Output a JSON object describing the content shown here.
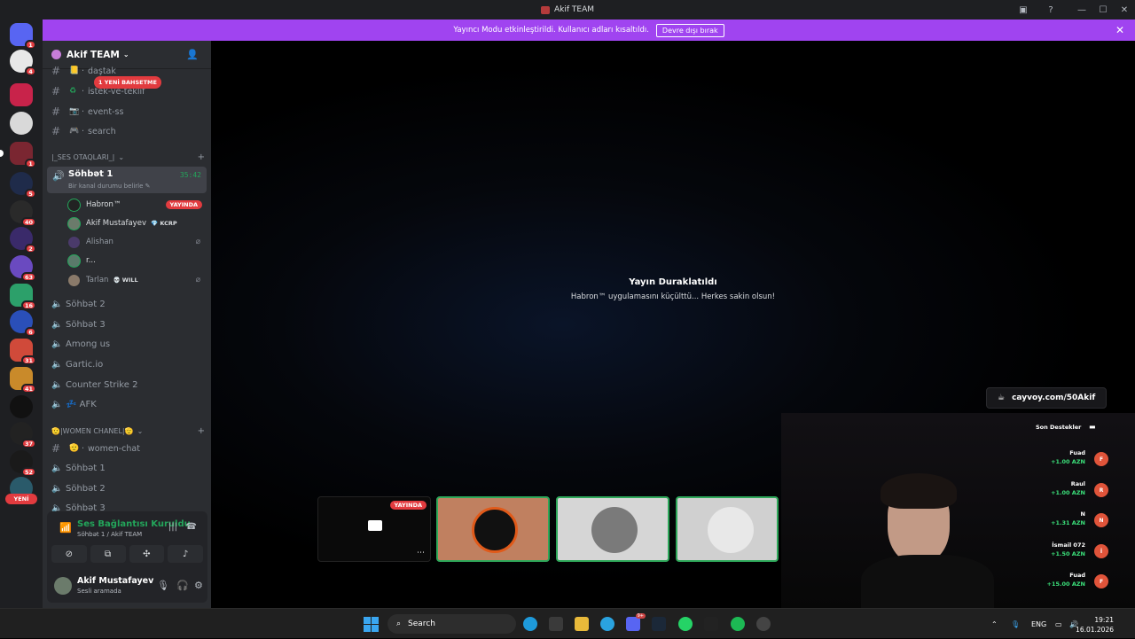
{
  "window": {
    "title": "Akif TEAM"
  },
  "banner": {
    "text": "Yayıncı Modu etkinleştirildi. Kullanıcı adları kısaltıldı.",
    "button": "Devre dışı bırak",
    "close_icon": "close-icon"
  },
  "guild_badges": [
    "1",
    "4",
    "1",
    "5",
    "40",
    "2",
    "63",
    "16",
    "6",
    "31",
    "41",
    "37",
    "52"
  ],
  "guild_new": "YENİ",
  "server": {
    "name": "Akif TEAM"
  },
  "mention_pill": "1 YENİ BAHSETME",
  "text_channels": [
    {
      "name": "daştak",
      "emoji": "📒"
    },
    {
      "name": "istek-ve-teklif",
      "emoji": "♻"
    },
    {
      "name": "event-ss",
      "emoji": "📷"
    },
    {
      "name": "search",
      "emoji": "🎮"
    }
  ],
  "categories": {
    "voice": "|_SES OTAQLARI_|",
    "women": "🫡|WOMEN CHANEL|🫡"
  },
  "active_voice": {
    "name": "Söhbət 1",
    "status": "Bir kanal durumu belirle",
    "timer": "35:42"
  },
  "voice_users": [
    {
      "name": "Habron™",
      "badge": "YAYINDA",
      "tag": ""
    },
    {
      "name": "Akif Mustafayev",
      "badge": "",
      "tag": "💎 KCRP"
    },
    {
      "name": "Alishan",
      "badge": "",
      "tag": ""
    },
    {
      "name": "r...",
      "badge": "",
      "tag": ""
    },
    {
      "name": "Tarlan",
      "badge": "",
      "tag": "💀 WILL"
    }
  ],
  "voice_channels": [
    {
      "name": "Söhbət 2"
    },
    {
      "name": "Söhbət 3"
    },
    {
      "name": "Among us"
    },
    {
      "name": "Gartic.io"
    },
    {
      "name": "Counter Strike 2"
    },
    {
      "name": "💤 AFK"
    }
  ],
  "women_channels": [
    {
      "name": "women-chat",
      "type": "text"
    },
    {
      "name": "Söhbət 1",
      "type": "voice"
    },
    {
      "name": "Söhbət 2",
      "type": "voice"
    },
    {
      "name": "Söhbət 3",
      "type": "voice"
    }
  ],
  "voice_panel": {
    "status": "Ses Bağlantısı Kuruldu",
    "sub": "Söhbət 1 / Akif TEAM"
  },
  "user": {
    "name": "Akif Mustafayev",
    "status": "Sesli aramada"
  },
  "stream": {
    "paused_title": "Yayın Duraklatıldı",
    "paused_sub": "Habron™ uygulamasını küçülttü... Herkes sakin olsun!",
    "tile_live": "YAYINDA"
  },
  "overlay": {
    "link": "cayvoy.com/50Akif",
    "support_title": "Son Destekler"
  },
  "donations": [
    {
      "name": "Fuad",
      "amount": "+1.00 AZN",
      "initial": "F"
    },
    {
      "name": "Raul",
      "amount": "+1.00 AZN",
      "initial": "R"
    },
    {
      "name": "N",
      "amount": "+1.31 AZN",
      "initial": "N"
    },
    {
      "name": "İsmail 072",
      "amount": "+1.50 AZN",
      "initial": "İ"
    },
    {
      "name": "Fuad",
      "amount": "+15.00 AZN",
      "initial": "F"
    }
  ],
  "taskbar": {
    "search": "Search",
    "lang": "ENG",
    "time": "19:21",
    "date": "16.01.2026",
    "discord_badge": "9+"
  },
  "colors": {
    "accent": "#a044f0",
    "live": "#e23b3f",
    "online": "#23a55a"
  }
}
